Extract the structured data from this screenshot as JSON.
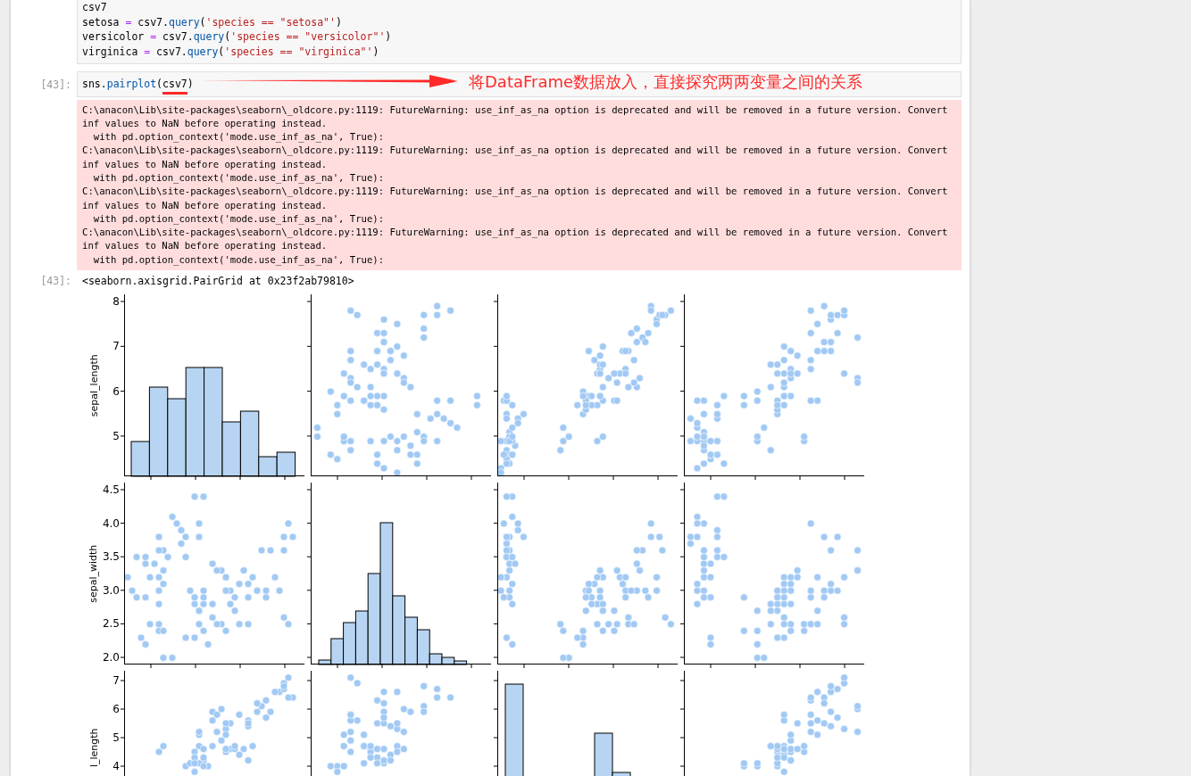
{
  "cells": [
    {
      "lines": [
        [
          {
            "text": "csv7",
            "kind": "plain"
          }
        ],
        [
          {
            "text": "setosa ",
            "kind": "plain"
          },
          {
            "text": "=",
            "kind": "op"
          },
          {
            "text": " csv7.",
            "kind": "plain"
          },
          {
            "text": "query",
            "kind": "attr"
          },
          {
            "text": "(",
            "kind": "plain"
          },
          {
            "text": "'species == \"setosa\"'",
            "kind": "str"
          },
          {
            "text": ")",
            "kind": "plain"
          }
        ],
        [
          {
            "text": "versicolor ",
            "kind": "plain"
          },
          {
            "text": "=",
            "kind": "op"
          },
          {
            "text": " csv7.",
            "kind": "plain"
          },
          {
            "text": "query",
            "kind": "attr"
          },
          {
            "text": "(",
            "kind": "plain"
          },
          {
            "text": "'species == \"versicolor\"'",
            "kind": "str"
          },
          {
            "text": ")",
            "kind": "plain"
          }
        ],
        [
          {
            "text": "virginica ",
            "kind": "plain"
          },
          {
            "text": "=",
            "kind": "op"
          },
          {
            "text": " csv7.",
            "kind": "plain"
          },
          {
            "text": "query",
            "kind": "attr"
          },
          {
            "text": "(",
            "kind": "plain"
          },
          {
            "text": "'species == \"virginica\"'",
            "kind": "str"
          },
          {
            "text": ")",
            "kind": "plain"
          }
        ]
      ]
    },
    {
      "prompt": "[43]:",
      "lines": [
        [
          {
            "text": "sns.",
            "kind": "plain"
          },
          {
            "text": "pairplot",
            "kind": "attr"
          },
          {
            "text": "(",
            "kind": "plain"
          },
          {
            "text": "csv7",
            "kind": "plain",
            "underlined": true
          },
          {
            "text": ")",
            "kind": "plain"
          }
        ]
      ],
      "annotation": "将DataFrame数据放入，直接探究两两变量之间的关系"
    }
  ],
  "stderr": [
    "C:\\anacon\\Lib\\site-packages\\seaborn\\_oldcore.py:1119: FutureWarning: use_inf_as_na option is deprecated and will be removed in a future version. Convert inf values to NaN before operating instead.",
    "  with pd.option_context('mode.use_inf_as_na', True):",
    "C:\\anacon\\Lib\\site-packages\\seaborn\\_oldcore.py:1119: FutureWarning: use_inf_as_na option is deprecated and will be removed in a future version. Convert inf values to NaN before operating instead.",
    "  with pd.option_context('mode.use_inf_as_na', True):",
    "C:\\anacon\\Lib\\site-packages\\seaborn\\_oldcore.py:1119: FutureWarning: use_inf_as_na option is deprecated and will be removed in a future version. Convert inf values to NaN before operating instead.",
    "  with pd.option_context('mode.use_inf_as_na', True):",
    "C:\\anacon\\Lib\\site-packages\\seaborn\\_oldcore.py:1119: FutureWarning: use_inf_as_na option is deprecated and will be removed in a future version. Convert inf values to NaN before operating instead.",
    "  with pd.option_context('mode.use_inf_as_na', True):"
  ],
  "result": {
    "prompt": "[43]:",
    "text": "<seaborn.axisgrid.PairGrid at 0x23f2ab79810>"
  },
  "pairplot": {
    "rows": [
      {
        "ylabel": "sepal_length",
        "yticks": [
          "8",
          "7",
          "6",
          "5"
        ]
      },
      {
        "ylabel": "sepal_width",
        "yticks": [
          "4.5",
          "4.0",
          "3.5",
          "3.0",
          "2.5",
          "2.0"
        ]
      },
      {
        "ylabel": "l_length",
        "yticks": [
          "7",
          "6",
          "5",
          "4"
        ]
      }
    ]
  }
}
